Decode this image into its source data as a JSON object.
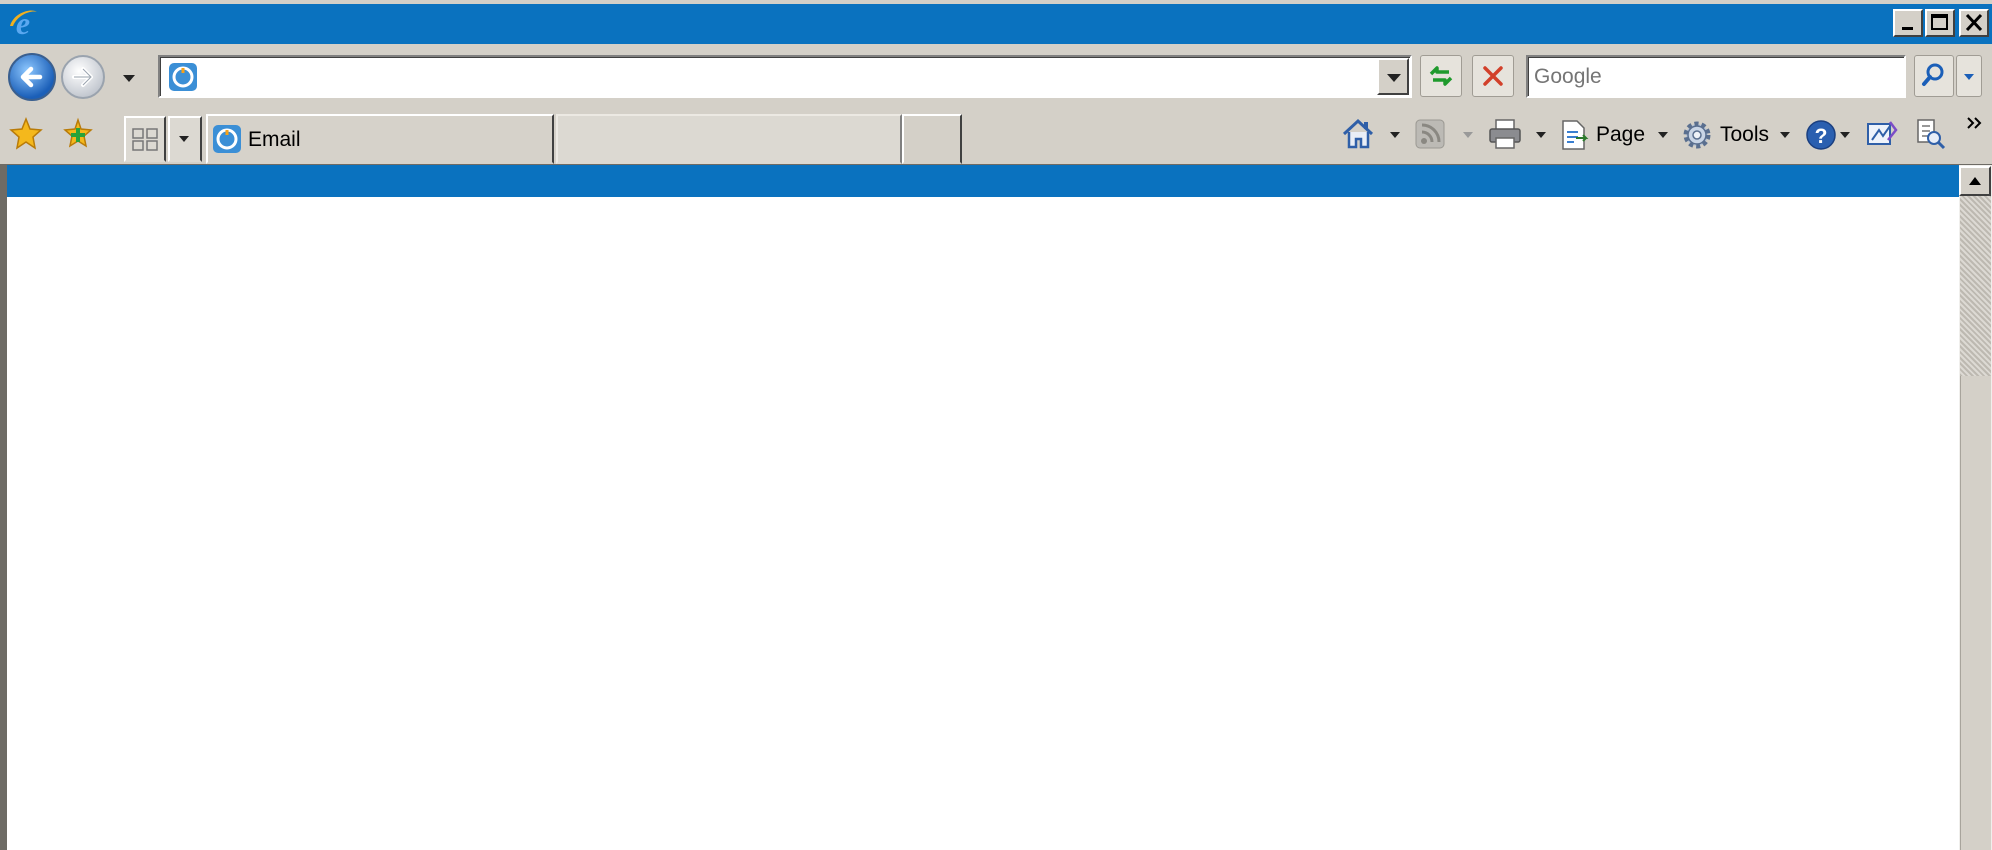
{
  "window": {
    "title": "",
    "controls": [
      "minimize",
      "maximize",
      "close"
    ],
    "colors": {
      "titlebar": "#0a72bf",
      "chrome": "#d4d0c8"
    }
  },
  "navigation": {
    "address": {
      "value": "",
      "favicon": "page-icon"
    },
    "search": {
      "placeholder": "Google"
    }
  },
  "tabs": [
    {
      "label": "Email",
      "icon": "page-icon",
      "active": true
    },
    {
      "label": "",
      "active": false
    }
  ],
  "command_bar": {
    "page_label": "Page",
    "tools_label": "Tools",
    "icons": [
      "home-icon",
      "feeds-icon",
      "print-icon",
      "page-icon",
      "tools-icon",
      "help-icon",
      "research-icon",
      "translate-icon"
    ]
  },
  "content": {
    "banner_color": "#0a72bf",
    "background": "#ffffff"
  }
}
